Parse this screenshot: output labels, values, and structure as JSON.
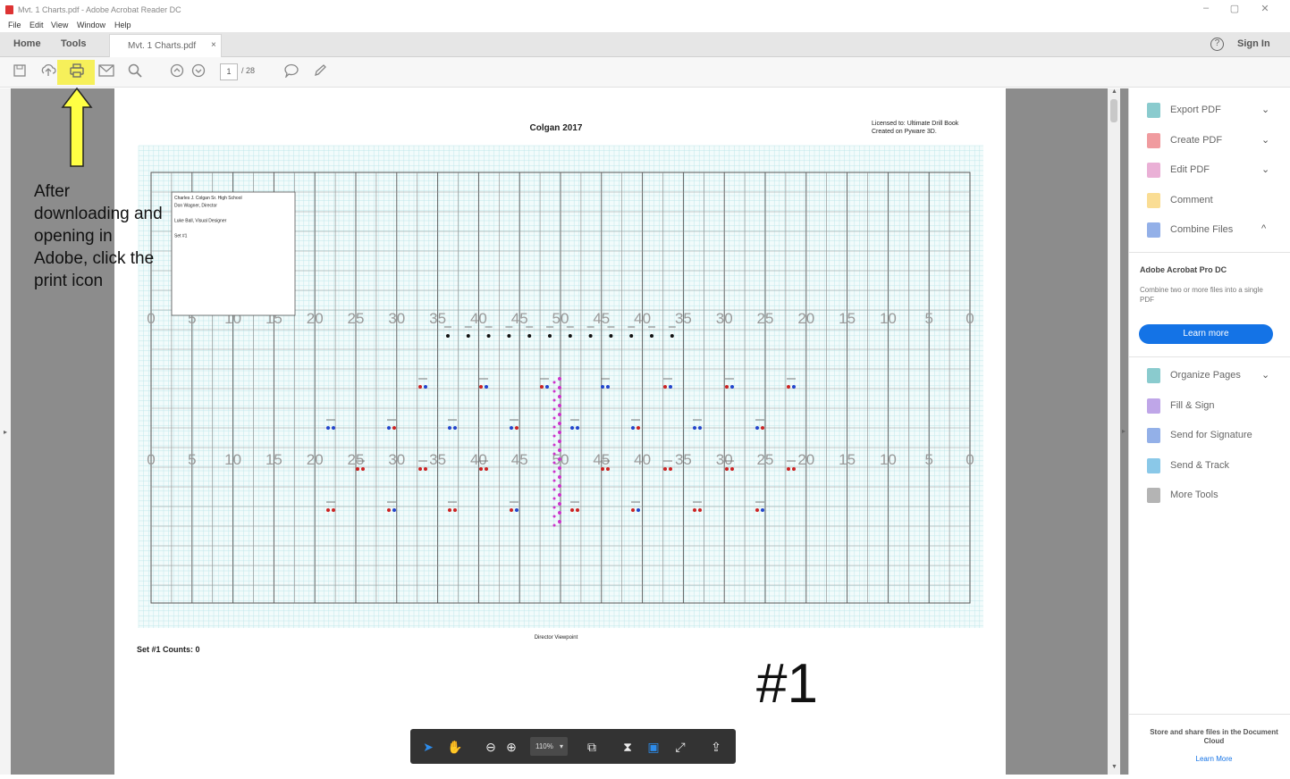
{
  "window": {
    "title": "Mvt. 1 Charts.pdf - Adobe Acrobat Reader DC",
    "controls": [
      "–",
      "▢",
      "✕"
    ]
  },
  "menu": [
    "File",
    "Edit",
    "View",
    "Window",
    "Help"
  ],
  "tabs": {
    "home": "Home",
    "tools": "Tools",
    "document": "Mvt. 1 Charts.pdf",
    "close": "×"
  },
  "header": {
    "help_icon": "?",
    "sign_in": "Sign In"
  },
  "toolbar": {
    "page_current": "1",
    "page_total": "/ 28",
    "highlight_color": "#f6f05a"
  },
  "document": {
    "title": "Colgan 2017",
    "license": "Licensed to: Ultimate Drill Book\nCreated on Pyware 3D.",
    "info_box": [
      "Charles J. Colgan Sr. High School",
      "Don Wagner, Director",
      "",
      "Luke Ball, Visual Designer",
      "",
      "Set #1"
    ],
    "yard_labels_back": [
      "0",
      "5",
      "10",
      "15",
      "20",
      "25",
      "30",
      "35",
      "40",
      "45",
      "50",
      "45",
      "40",
      "35",
      "30",
      "25",
      "20",
      "15",
      "10",
      "5",
      "0"
    ],
    "yard_labels_front": [
      "0",
      "5",
      "10",
      "15",
      "20",
      "25",
      "30",
      "35",
      "40",
      "45",
      "50",
      "45",
      "40",
      "35",
      "30",
      "25",
      "20",
      "15",
      "10",
      "5",
      "0"
    ],
    "viewpoint": "Director Viewpoint",
    "set_info": "Set #1   Counts: 0"
  },
  "annotation": {
    "text": "After downloading and opening in Adobe, click the print icon",
    "arrow_color": "#ffff44",
    "number": "#1"
  },
  "right_panel": {
    "tools": [
      {
        "label": "Export PDF",
        "chevron": "⌄",
        "icon": "export-pdf-icon",
        "color": "#2aa1a6"
      },
      {
        "label": "Create PDF",
        "chevron": "⌄",
        "icon": "create-pdf-icon",
        "color": "#e34850"
      },
      {
        "label": "Edit PDF",
        "chevron": "⌄",
        "icon": "edit-pdf-icon",
        "color": "#d86fb5"
      },
      {
        "label": "Comment",
        "chevron": "",
        "icon": "comment-icon",
        "color": "#f5c13c"
      },
      {
        "label": "Combine Files",
        "chevron": "^",
        "icon": "combine-files-icon",
        "color": "#3b6fd6"
      }
    ],
    "promo": {
      "title": "Adobe Acrobat Pro DC",
      "description": "Combine two or more files into a single PDF",
      "button": "Learn more"
    },
    "more_tools": [
      {
        "label": "Organize Pages",
        "chevron": "⌄",
        "icon": "organize-pages-icon",
        "color": "#2aa1a6"
      },
      {
        "label": "Fill & Sign",
        "chevron": "",
        "icon": "fill-sign-icon",
        "color": "#8a5cd6"
      },
      {
        "label": "Send for Signature",
        "chevron": "",
        "icon": "send-signature-icon",
        "color": "#3b6fd6"
      },
      {
        "label": "Send & Track",
        "chevron": "",
        "icon": "send-track-icon",
        "color": "#2a9bd6"
      },
      {
        "label": "More Tools",
        "chevron": "",
        "icon": "more-tools-icon",
        "color": "#777777"
      }
    ],
    "footer_text": "Store and share files in the Document Cloud",
    "footer_link": "Learn More"
  },
  "floating_toolbar": {
    "zoom": "110%"
  }
}
